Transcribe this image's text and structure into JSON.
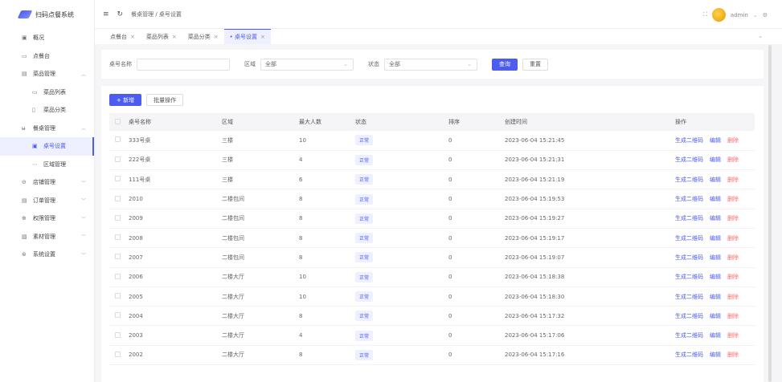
{
  "app": {
    "title": "扫码点餐系统"
  },
  "sidebar": {
    "items": [
      {
        "label": "概况",
        "icon": "dashboard-icon",
        "glyph": "▣"
      },
      {
        "label": "点餐台",
        "icon": "monitor-icon",
        "glyph": "▭"
      },
      {
        "label": "菜品管理",
        "icon": "menu-icon",
        "glyph": "▤",
        "chev": "^"
      },
      {
        "label": "菜品列表",
        "icon": "list-icon",
        "glyph": "▭",
        "sub": true
      },
      {
        "label": "菜品分类",
        "icon": "bookmark-icon",
        "glyph": "▯",
        "sub": true
      },
      {
        "label": "餐桌管理",
        "icon": "cutlery-icon",
        "glyph": "ʉ",
        "chev": "^"
      },
      {
        "label": "桌号设置",
        "icon": "table-icon",
        "glyph": "▣",
        "sub": true,
        "active": true
      },
      {
        "label": "区域管理",
        "icon": "dots-icon",
        "glyph": "⋯",
        "sub": true
      },
      {
        "label": "店铺管理",
        "icon": "store-icon",
        "glyph": "⊖",
        "chev": "v"
      },
      {
        "label": "订单管理",
        "icon": "order-icon",
        "glyph": "▤",
        "chev": "v"
      },
      {
        "label": "权限管理",
        "icon": "lock-icon",
        "glyph": "⊕",
        "chev": "v"
      },
      {
        "label": "素材管理",
        "icon": "image-icon",
        "glyph": "▨",
        "chev": "v"
      },
      {
        "label": "系统设置",
        "icon": "gear-icon",
        "glyph": "⊛",
        "chev": "v"
      }
    ]
  },
  "header": {
    "breadcrumb": [
      "餐桌管理",
      "桌号设置"
    ],
    "user": "admin"
  },
  "tabs": [
    {
      "label": "点餐台"
    },
    {
      "label": "菜品列表"
    },
    {
      "label": "菜品分类"
    },
    {
      "label": "桌号设置",
      "active": true
    }
  ],
  "search": {
    "name_label": "桌号名称",
    "name_value": "",
    "area_label": "区域",
    "area_value": "全部",
    "status_label": "状态",
    "status_value": "全部",
    "query": "查询",
    "reset": "重置"
  },
  "toolbar": {
    "add": "+ 新增",
    "batch": "批量操作"
  },
  "table": {
    "columns": [
      "桌号名称",
      "区域",
      "最大人数",
      "状态",
      "排序",
      "创建时间",
      "操作"
    ],
    "rows": [
      [
        "333号桌",
        "三楼",
        "10",
        "正常",
        "0",
        "2023-06-04 15:21:45"
      ],
      [
        "222号桌",
        "三楼",
        "4",
        "正常",
        "0",
        "2023-06-04 15:21:31"
      ],
      [
        "111号桌",
        "三楼",
        "6",
        "正常",
        "0",
        "2023-06-04 15:21:19"
      ],
      [
        "2010",
        "二楼包间",
        "8",
        "正常",
        "0",
        "2023-06-04 15:19:53"
      ],
      [
        "2009",
        "二楼包间",
        "8",
        "正常",
        "0",
        "2023-06-04 15:19:27"
      ],
      [
        "2008",
        "二楼包间",
        "8",
        "正常",
        "0",
        "2023-06-04 15:19:17"
      ],
      [
        "2007",
        "二楼包间",
        "8",
        "正常",
        "0",
        "2023-06-04 15:19:07"
      ],
      [
        "2006",
        "二楼大厅",
        "10",
        "正常",
        "0",
        "2023-06-04 15:18:38"
      ],
      [
        "2005",
        "二楼大厅",
        "10",
        "正常",
        "0",
        "2023-06-04 15:18:30"
      ],
      [
        "2004",
        "二楼大厅",
        "8",
        "正常",
        "0",
        "2023-06-04 15:17:32"
      ],
      [
        "2003",
        "二楼大厅",
        "4",
        "正常",
        "0",
        "2023-06-04 15:17:06"
      ],
      [
        "2002",
        "二楼大厅",
        "8",
        "正常",
        "0",
        "2023-06-04 15:17:16"
      ]
    ],
    "actions": {
      "qr": "生成二维码",
      "edit": "编辑",
      "delete": "删除"
    }
  },
  "colors": {
    "accent": "#4c5cf0",
    "danger": "#f56c6c"
  }
}
